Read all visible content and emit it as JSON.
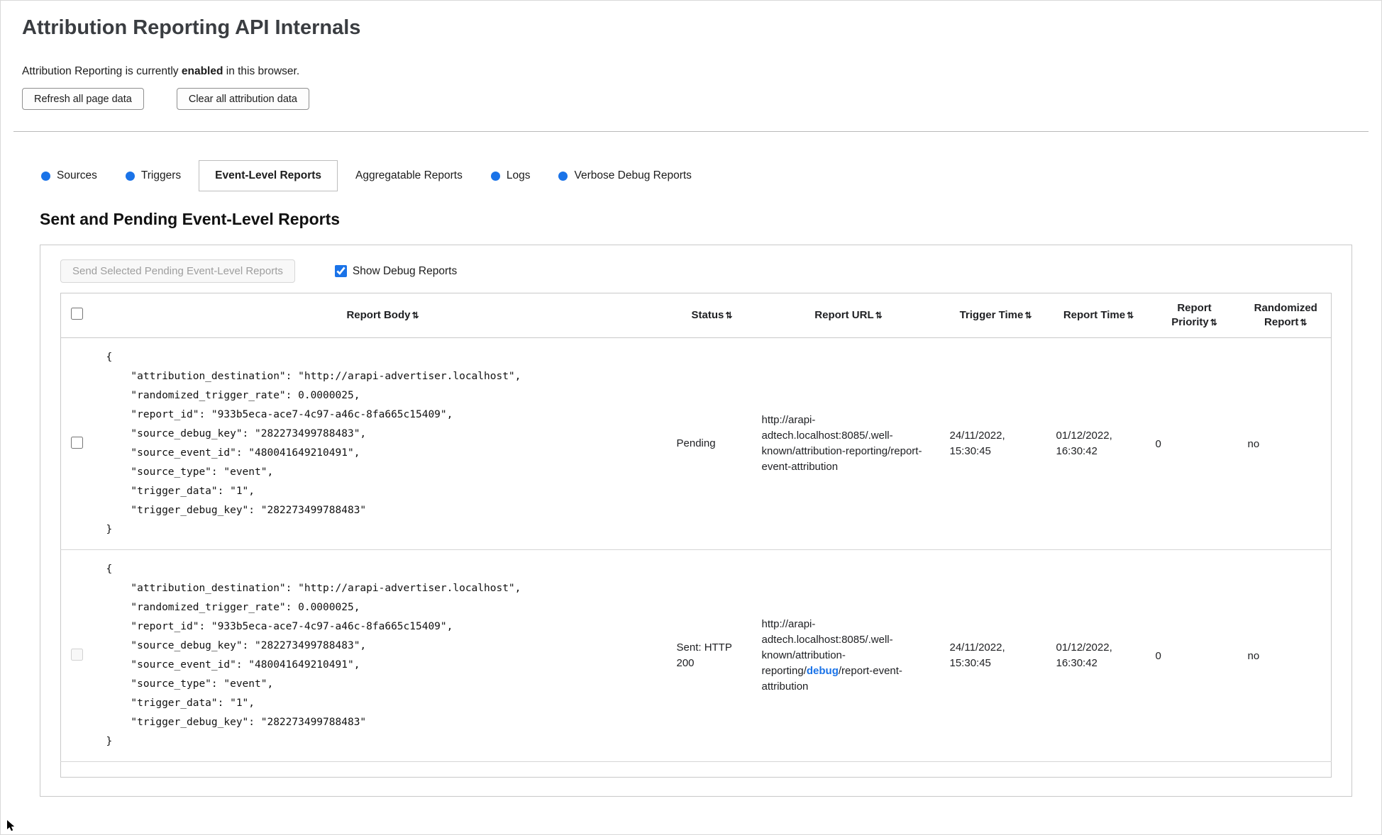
{
  "page": {
    "title": "Attribution Reporting API Internals",
    "status_prefix": "Attribution Reporting is currently ",
    "status_bold": "enabled",
    "status_suffix": " in this browser.",
    "refresh_button": "Refresh all page data",
    "clear_button": "Clear all attribution data"
  },
  "tabs": [
    {
      "label": "Sources",
      "has_new_data_dot": true
    },
    {
      "label": "Triggers",
      "has_new_data_dot": true
    },
    {
      "label": "Event-Level Reports",
      "active": true
    },
    {
      "label": "Aggregatable Reports"
    },
    {
      "label": "Logs",
      "has_new_data_dot": true
    },
    {
      "label": "Verbose Debug Reports",
      "has_new_data_dot": true
    }
  ],
  "section": {
    "title": "Sent and Pending Event-Level Reports",
    "send_button": "Send Selected Pending Event-Level Reports",
    "show_debug_label": "Show Debug Reports",
    "show_debug_checked": true
  },
  "colors": {
    "accent_blue": "#1a73e8",
    "tab_dot": "#1a73e8",
    "debug_highlight": "#1a73e8"
  },
  "table": {
    "sort_glyph": "⇅",
    "headers": [
      "Report Body",
      "Status",
      "Report URL",
      "Trigger Time",
      "Report Time",
      "Report Priority",
      "Randomized Report"
    ],
    "rows": [
      {
        "body": "{\n    \"attribution_destination\": \"http://arapi-advertiser.localhost\",\n    \"randomized_trigger_rate\": 0.0000025,\n    \"report_id\": \"933b5eca-ace7-4c97-a46c-8fa665c15409\",\n    \"source_debug_key\": \"282273499788483\",\n    \"source_event_id\": \"480041649210491\",\n    \"source_type\": \"event\",\n    \"trigger_data\": \"1\",\n    \"trigger_debug_key\": \"282273499788483\"\n}",
        "status": "Pending",
        "url_prefix": "http://arapi-adtech.localhost:8085/.well-known/attribution-reporting/report-event-attribution",
        "url_debug": "",
        "url_suffix": "",
        "trigger_time": "24/11/2022, 15:30:45",
        "report_time": "01/12/2022, 16:30:42",
        "priority": "0",
        "randomized": "no"
      },
      {
        "body": "{\n    \"attribution_destination\": \"http://arapi-advertiser.localhost\",\n    \"randomized_trigger_rate\": 0.0000025,\n    \"report_id\": \"933b5eca-ace7-4c97-a46c-8fa665c15409\",\n    \"source_debug_key\": \"282273499788483\",\n    \"source_event_id\": \"480041649210491\",\n    \"source_type\": \"event\",\n    \"trigger_data\": \"1\",\n    \"trigger_debug_key\": \"282273499788483\"\n}",
        "status": "Sent: HTTP 200",
        "url_prefix": "http://arapi-adtech.localhost:8085/.well-known/attribution-reporting/",
        "url_debug": "debug",
        "url_suffix": "/report-event-attribution",
        "trigger_time": "24/11/2022, 15:30:45",
        "report_time": "01/12/2022, 16:30:42",
        "priority": "0",
        "randomized": "no"
      }
    ]
  }
}
